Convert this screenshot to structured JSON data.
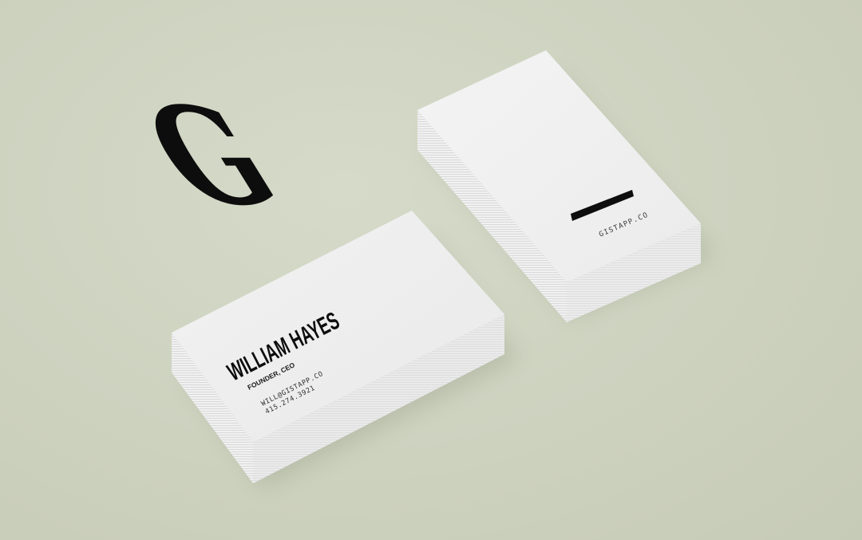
{
  "scene": {
    "background_color": "#cfd4c2",
    "card_color": "#efefef",
    "ink_color": "#0d0d0d"
  },
  "front_card": {
    "name": "WILLIAM HAYES",
    "title": "FOUNDER, CEO",
    "email": "WILL@GISTAPP.CO",
    "phone": "415.274.3921"
  },
  "back_card": {
    "logo_letter": "G",
    "website": "GISTAPP.CO"
  }
}
